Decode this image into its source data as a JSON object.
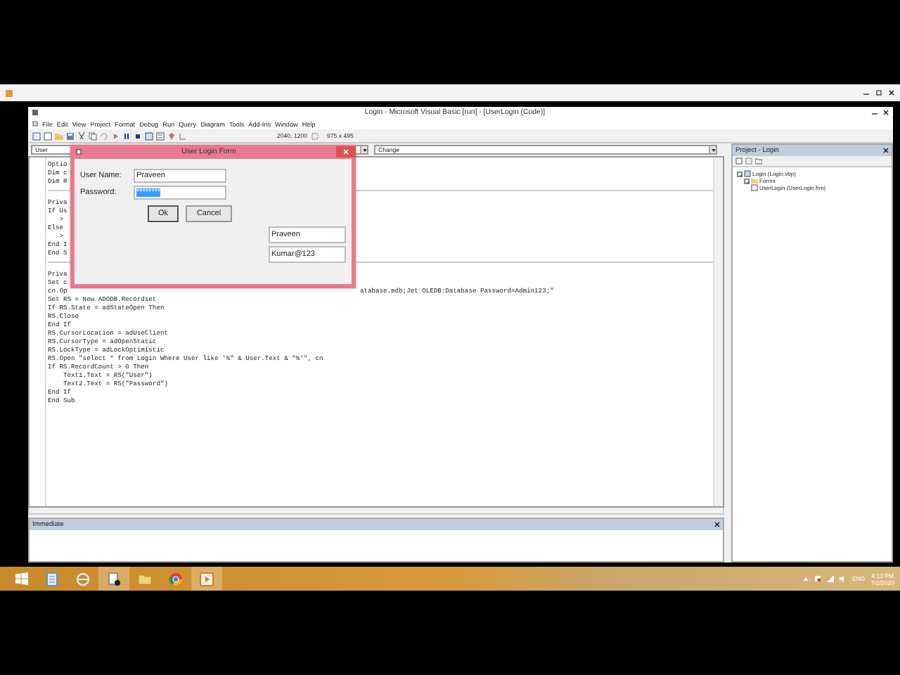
{
  "window": {
    "title": "Login - Microsoft Visual Basic [run] - [UserLogin (Code)]"
  },
  "menu": [
    "File",
    "Edit",
    "View",
    "Project",
    "Format",
    "Debug",
    "Run",
    "Query",
    "Diagram",
    "Tools",
    "Add-Ins",
    "Window",
    "Help"
  ],
  "toolbar": {
    "position": "2040, 1200",
    "size": "975 x 495"
  },
  "code_pane": {
    "object_combo": "User",
    "procedure_combo": "Change",
    "lines": [
      {
        "kind": "code",
        "text": "Optio"
      },
      {
        "kind": "code",
        "text": "Dim c"
      },
      {
        "kind": "code",
        "text": "Dim R"
      },
      {
        "kind": "separator"
      },
      {
        "kind": "code",
        "text": "Priva"
      },
      {
        "kind": "code",
        "text": "If Us"
      },
      {
        "kind": "code",
        "text": "   >"
      },
      {
        "kind": "code",
        "text": "Else"
      },
      {
        "kind": "code",
        "text": "   >"
      },
      {
        "kind": "code",
        "text": "End I"
      },
      {
        "kind": "code",
        "text": "End S"
      },
      {
        "kind": "separator"
      },
      {
        "kind": "code",
        "text": "Priva"
      },
      {
        "kind": "code",
        "text": "Set c"
      },
      {
        "kind": "code",
        "text": "cn.Op",
        "after": "atabase.mdb;Jet OLEDB:Database Password=Admin123;\""
      },
      {
        "kind": "code",
        "text": "Set RS = New ADODB.Recordset"
      },
      {
        "kind": "code",
        "text": "If RS.State = adStateOpen Then"
      },
      {
        "kind": "code",
        "text": "RS.Close"
      },
      {
        "kind": "code",
        "text": "End If"
      },
      {
        "kind": "code",
        "text": "RS.CursorLocation = adUseClient"
      },
      {
        "kind": "code",
        "text": "RS.CursorType = adOpenStatic"
      },
      {
        "kind": "code",
        "text": "RS.LockType = adLockOptimistic"
      },
      {
        "kind": "code",
        "text": "RS.Open \"select * from Login Where User like '%\" & User.Text & \"%'\", cn"
      },
      {
        "kind": "code",
        "text": "If RS.RecordCount > 0 Then"
      },
      {
        "kind": "code",
        "text": "    Text1.Text = RS(\"User\")"
      },
      {
        "kind": "code",
        "text": "    Text2.Text = RS(\"Password\")"
      },
      {
        "kind": "code",
        "text": "End If"
      },
      {
        "kind": "code",
        "text": "End Sub"
      }
    ]
  },
  "dialog": {
    "title": "User Login Form",
    "fields": [
      {
        "label": "User Name:",
        "value": "Praveen",
        "selected": false
      },
      {
        "label": "Password:",
        "value": "********",
        "selected": true
      }
    ],
    "buttons": [
      "Ok",
      "Cancel"
    ],
    "text_boxes": [
      "Praveen",
      "Kumar@123"
    ]
  },
  "project": {
    "title": "Project - Login",
    "tree": [
      {
        "label": "Login (Login.vbp)",
        "expanded": true,
        "children": [
          {
            "label": "Forms",
            "expanded": true,
            "children": [
              {
                "label": "UserLogin (UserLogin.frm)"
              }
            ]
          }
        ]
      }
    ]
  },
  "immediate": {
    "title": "Immediate"
  },
  "taskbar": {
    "apps": [
      {
        "kind": "notes",
        "selected": false
      },
      {
        "kind": "browser",
        "selected": false
      },
      {
        "kind": "file",
        "selected": true
      },
      {
        "kind": "folder",
        "selected": false
      },
      {
        "kind": "chrome",
        "selected": false
      },
      {
        "kind": "player",
        "selected": true
      }
    ],
    "language": "ENG",
    "time": "4:13 PM",
    "date": "7/2/2020"
  }
}
